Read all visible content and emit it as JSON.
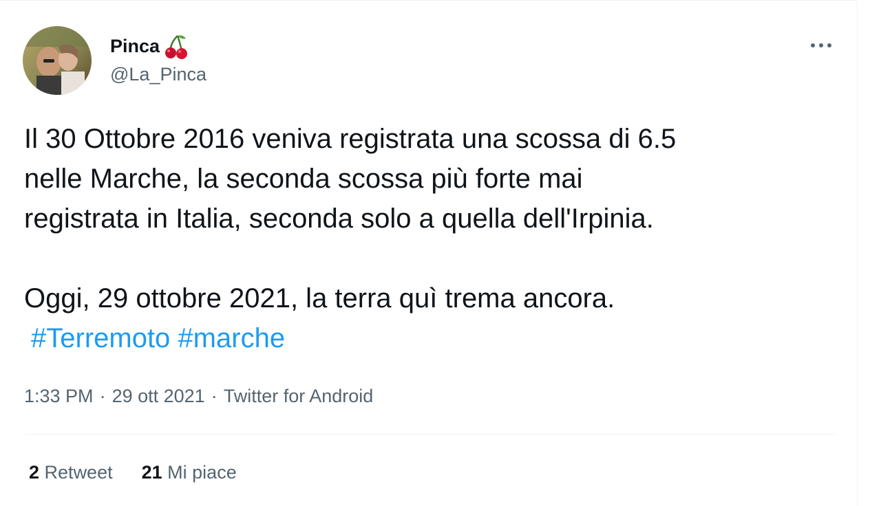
{
  "tweet": {
    "author": {
      "display_name": "Pinca",
      "name_emoji_icon": "cherry-icon",
      "handle": "@La_Pinca"
    },
    "more_icon": "more-options-icon",
    "text_lines": [
      "Il 30 Ottobre 2016 veniva registrata una scossa di 6.5",
      "nelle Marche, la seconda scossa più forte mai",
      "registrata in Italia, seconda solo a quella dell'Irpinia.",
      "Oggi, 29 ottobre 2021, la terra quì trema ancora."
    ],
    "hashtags": [
      "#Terremoto",
      "#marche"
    ],
    "meta": {
      "time": "1:33 PM",
      "date": "29 ott 2021",
      "separator": "·",
      "source": "Twitter for Android"
    },
    "stats": {
      "retweets_count": "2",
      "retweets_label": "Retweet",
      "likes_count": "21",
      "likes_label": "Mi piace"
    },
    "colors": {
      "link": "#1d9bf0",
      "secondary_text": "#536471",
      "primary_text": "#0f1419",
      "divider": "#eff3f4"
    }
  }
}
